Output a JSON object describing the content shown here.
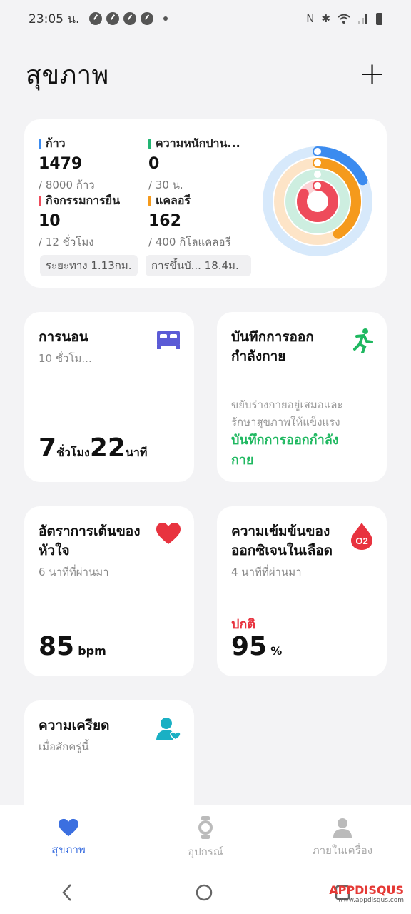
{
  "status_bar": {
    "time": "23:05 น.",
    "icons": [
      "nfc-icon",
      "bluetooth-icon",
      "wifi-icon",
      "signal-icon",
      "battery-icon"
    ]
  },
  "header": {
    "title": "สุขภาพ",
    "add_label": "+"
  },
  "summary": {
    "steps": {
      "label": "ก้าว",
      "value": "1479",
      "goal": "/ 8000 ก้าว",
      "color": "#3b8bef"
    },
    "intensity": {
      "label": "ความหนักปาน...",
      "value": "0",
      "goal": "/ 30 น.",
      "color": "#22b573"
    },
    "stand": {
      "label": "กิจกรรมการยืน",
      "value": "10",
      "goal": "/ 12 ชั่วโมง",
      "color": "#ee4b5b"
    },
    "calories": {
      "label": "แคลอรี",
      "value": "162",
      "goal": "/ 400 กิโลแคลอรี",
      "color": "#f59a1c"
    },
    "distance": "ระยะทาง 1.13กม.",
    "floors": "การขึ้นบั...   18.4ม.",
    "rings": {
      "steps_fraction": 0.18,
      "calories_fraction": 0.41,
      "intensity_fraction": 0.0,
      "stand_fraction": 0.83
    }
  },
  "sleep": {
    "title": "การนอน",
    "sub": "10 ชั่วโม...",
    "hours": "7",
    "hours_unit": "ชั่วโมง",
    "minutes": "22",
    "minutes_unit": "นาที"
  },
  "exercise": {
    "title_line1": "บันทึกการออก",
    "title_line2": "กำลังกาย",
    "desc_line1": "ขยับร่างกายอยู่เสมอและ",
    "desc_line2": "รักษาสุขภาพให้แข็งแรง",
    "link_line1": "บันทึกการออกกำลัง",
    "link_line2": "กาย"
  },
  "heart": {
    "title_line1": "อัตราการเต้นของ",
    "title_line2": "หัวใจ",
    "sub": "6 นาทีที่ผ่านมา",
    "value": "85",
    "unit": "bpm"
  },
  "oxygen": {
    "title_line1": "ความเข้มข้นของ",
    "title_line2": "ออกซิเจนในเลือด",
    "sub": "4 นาทีที่ผ่านมา",
    "status": "ปกติ",
    "value": "95",
    "unit": "%",
    "badge": "O2"
  },
  "stress": {
    "title": "ความเครียด",
    "sub": "เมื่อสักครู่นี้"
  },
  "nav": [
    {
      "label": "สุขภาพ",
      "icon": "heart-icon",
      "active": true
    },
    {
      "label": "อุปกรณ์",
      "icon": "watch-icon",
      "active": false
    },
    {
      "label": "ภายในเครื่อง",
      "icon": "person-icon",
      "active": false
    }
  ],
  "watermark": {
    "brand": "APPDISQUS",
    "url": "www.appdisqus.com"
  }
}
